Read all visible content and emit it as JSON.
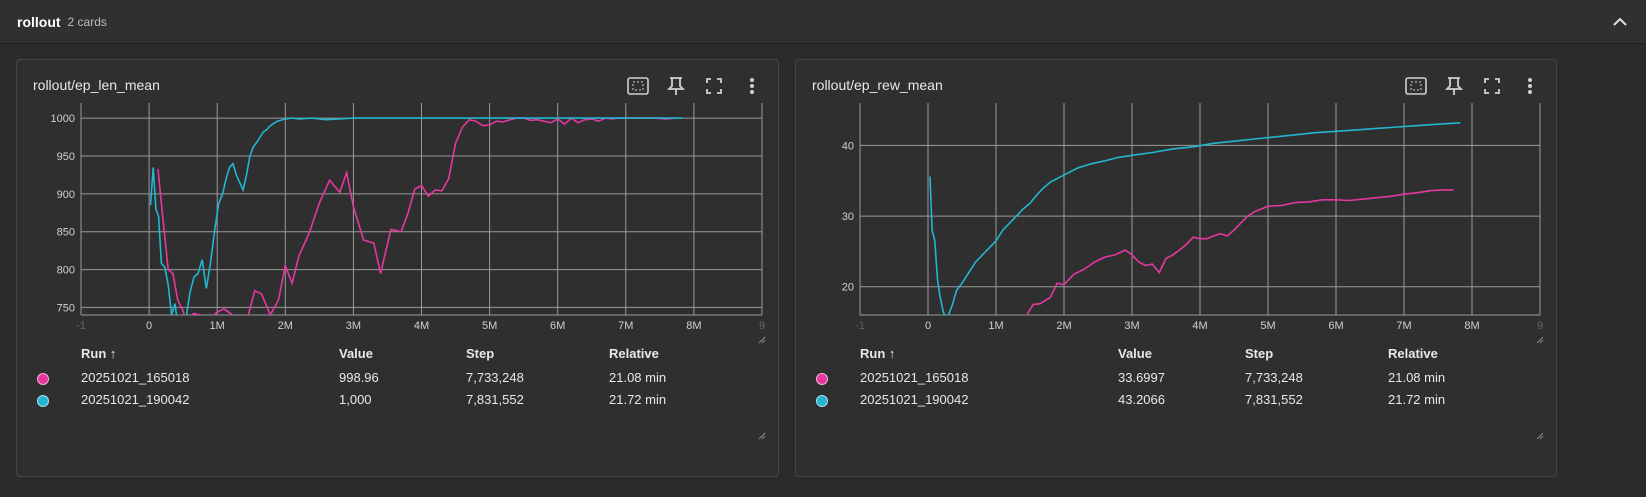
{
  "group": {
    "title": "rollout",
    "count": "2 cards"
  },
  "colors": {
    "run1": "#e5389f",
    "run2": "#22b6d0",
    "grid": "#9a9a9a"
  },
  "icons": [
    "chevron-up-icon",
    "fit-domain-icon",
    "pin-icon",
    "fullscreen-icon",
    "more-vert-icon"
  ],
  "table_headers": {
    "run": "Run ↑",
    "value": "Value",
    "step": "Step",
    "relative": "Relative"
  },
  "cards": [
    {
      "title": "rollout/ep_len_mean",
      "rows": [
        {
          "run": "20251021_165018",
          "value": "998.96",
          "step": "7,733,248",
          "relative": "21.08 min"
        },
        {
          "run": "20251021_190042",
          "value": "1,000",
          "step": "7,831,552",
          "relative": "21.72 min"
        }
      ]
    },
    {
      "title": "rollout/ep_rew_mean",
      "rows": [
        {
          "run": "20251021_165018",
          "value": "33.6997",
          "step": "7,733,248",
          "relative": "21.08 min"
        },
        {
          "run": "20251021_190042",
          "value": "43.2066",
          "step": "7,831,552",
          "relative": "21.72 min"
        }
      ]
    }
  ],
  "chart_data": [
    {
      "type": "line",
      "title": "rollout/ep_len_mean",
      "x_ticks": [
        "-1",
        "0",
        "1M",
        "2M",
        "3M",
        "4M",
        "5M",
        "6M",
        "7M",
        "8M",
        "9"
      ],
      "x_tick_values": [
        -1000000,
        0,
        1000000,
        2000000,
        3000000,
        4000000,
        5000000,
        6000000,
        7000000,
        8000000,
        9000000
      ],
      "y_ticks": [
        "750",
        "800",
        "850",
        "900",
        "950",
        "1000"
      ],
      "y_tick_values": [
        750,
        800,
        850,
        900,
        950,
        1000
      ],
      "xlim": [
        -1000000,
        9000000
      ],
      "ylim": [
        740,
        1020
      ],
      "grid": true,
      "series": [
        {
          "name": "20251021_165018",
          "color": "#e5389f",
          "x": [
            130000,
            200000,
            280000,
            350000,
            420000,
            500000,
            580000,
            650000,
            750000,
            900000,
            1000000,
            1100000,
            1150000,
            1300000,
            1400000,
            1550000,
            1650000,
            1780000,
            1900000,
            2000000,
            2100000,
            2200000,
            2350000,
            2500000,
            2650000,
            2800000,
            2900000,
            3000000,
            3150000,
            3300000,
            3400000,
            3550000,
            3700000,
            3800000,
            3900000,
            4000000,
            4100000,
            4200000,
            4300000,
            4400000,
            4500000,
            4600000,
            4700000,
            4800000,
            4900000,
            5000000,
            5100000,
            5200000,
            5300000,
            5400000,
            5500000,
            5600000,
            5700000,
            5800000,
            5900000,
            6000000,
            6100000,
            6200000,
            6300000,
            6400000,
            6500000,
            6600000,
            6700000,
            6800000,
            6900000,
            7000000,
            7200000,
            7400000,
            7600000,
            7730000
          ],
          "y": [
            933,
            870,
            800,
            795,
            760,
            745,
            720,
            742,
            740,
            735,
            744,
            748,
            745,
            735,
            720,
            772,
            768,
            740,
            760,
            805,
            782,
            818,
            848,
            888,
            918,
            902,
            928,
            883,
            839,
            835,
            795,
            853,
            850,
            874,
            906,
            911,
            897,
            905,
            904,
            920,
            967,
            988,
            998,
            996,
            990,
            991,
            996,
            995,
            998,
            1000,
            1000,
            997,
            998,
            996,
            994,
            999,
            992,
            1000,
            994,
            998,
            999,
            996,
            1000,
            999,
            1000,
            1000,
            1000,
            1000,
            999,
            1000
          ]
        },
        {
          "name": "20251021_190042",
          "color": "#22b6d0",
          "x": [
            20000,
            60000,
            100000,
            140000,
            180000,
            230000,
            280000,
            330000,
            380000,
            430000,
            480000,
            540000,
            600000,
            660000,
            720000,
            780000,
            840000,
            900000,
            960000,
            1020000,
            1080000,
            1130000,
            1180000,
            1230000,
            1280000,
            1330000,
            1380000,
            1430000,
            1480000,
            1530000,
            1580000,
            1630000,
            1680000,
            1730000,
            1780000,
            1830000,
            1880000,
            1930000,
            2000000,
            2100000,
            2200000,
            2400000,
            2600000,
            3000000,
            4000000,
            5000000,
            6000000,
            7000000,
            7830000
          ],
          "y": [
            885,
            935,
            880,
            870,
            808,
            803,
            780,
            740,
            755,
            720,
            720,
            735,
            770,
            790,
            795,
            813,
            775,
            808,
            850,
            887,
            900,
            920,
            935,
            940,
            925,
            915,
            905,
            925,
            950,
            962,
            968,
            975,
            982,
            985,
            990,
            993,
            996,
            997,
            999,
            1000,
            999,
            1000,
            998,
            1000,
            1000,
            1000,
            1000,
            1000,
            1000
          ]
        }
      ]
    },
    {
      "type": "line",
      "title": "rollout/ep_rew_mean",
      "x_ticks": [
        "-1",
        "0",
        "1M",
        "2M",
        "3M",
        "4M",
        "5M",
        "6M",
        "7M",
        "8M",
        "9"
      ],
      "x_tick_values": [
        -1000000,
        0,
        1000000,
        2000000,
        3000000,
        4000000,
        5000000,
        6000000,
        7000000,
        8000000,
        9000000
      ],
      "y_ticks": [
        "20",
        "30",
        "40"
      ],
      "y_tick_values": [
        20,
        30,
        40
      ],
      "xlim": [
        -1000000,
        9000000
      ],
      "ylim": [
        16,
        46
      ],
      "grid": true,
      "series": [
        {
          "name": "20251021_165018",
          "color": "#e5389f",
          "x": [
            1350000,
            1450000,
            1550000,
            1650000,
            1800000,
            1900000,
            2000000,
            2150000,
            2300000,
            2450000,
            2600000,
            2750000,
            2900000,
            3000000,
            3100000,
            3200000,
            3300000,
            3400000,
            3500000,
            3600000,
            3700000,
            3800000,
            3900000,
            4000000,
            4100000,
            4200000,
            4300000,
            4400000,
            4500000,
            4600000,
            4700000,
            4800000,
            4900000,
            5000000,
            5200000,
            5400000,
            5600000,
            5800000,
            6000000,
            6200000,
            6400000,
            6600000,
            6800000,
            7000000,
            7200000,
            7400000,
            7600000,
            7730000
          ],
          "y": [
            15,
            16,
            17.5,
            17.6,
            18.5,
            20.5,
            20.3,
            21.8,
            22.5,
            23.5,
            24.2,
            24.5,
            25.2,
            24.5,
            23.5,
            23,
            23.2,
            22,
            24,
            24.5,
            25.2,
            26,
            27,
            26.8,
            26.8,
            27.2,
            27.5,
            27.2,
            28,
            29,
            30,
            30.6,
            31,
            31.4,
            31.5,
            31.9,
            32,
            32.3,
            32.3,
            32.2,
            32.4,
            32.6,
            32.8,
            33.1,
            33.3,
            33.6,
            33.7,
            33.7
          ]
        },
        {
          "name": "20251021_190042",
          "color": "#22b6d0",
          "x": [
            30000,
            60000,
            100000,
            140000,
            180000,
            220000,
            260000,
            300000,
            360000,
            420000,
            500000,
            600000,
            700000,
            800000,
            900000,
            1000000,
            1100000,
            1200000,
            1300000,
            1400000,
            1500000,
            1600000,
            1700000,
            1800000,
            1900000,
            2000000,
            2200000,
            2400000,
            2600000,
            2800000,
            3000000,
            3300000,
            3600000,
            3900000,
            4200000,
            4500000,
            4800000,
            5100000,
            5400000,
            5700000,
            6000000,
            6300000,
            6600000,
            6900000,
            7200000,
            7500000,
            7830000
          ],
          "y": [
            35.6,
            28,
            26.5,
            21,
            18.5,
            16.6,
            15.5,
            16,
            17.5,
            19.5,
            20.5,
            22,
            23.5,
            24.5,
            25.5,
            26.5,
            28,
            29,
            30,
            31,
            31.8,
            33,
            34,
            34.8,
            35.3,
            35.8,
            36.8,
            37.4,
            37.8,
            38.3,
            38.6,
            39,
            39.5,
            39.8,
            40.3,
            40.6,
            40.9,
            41.2,
            41.5,
            41.8,
            42,
            42.2,
            42.4,
            42.6,
            42.8,
            43,
            43.2
          ]
        }
      ]
    }
  ]
}
